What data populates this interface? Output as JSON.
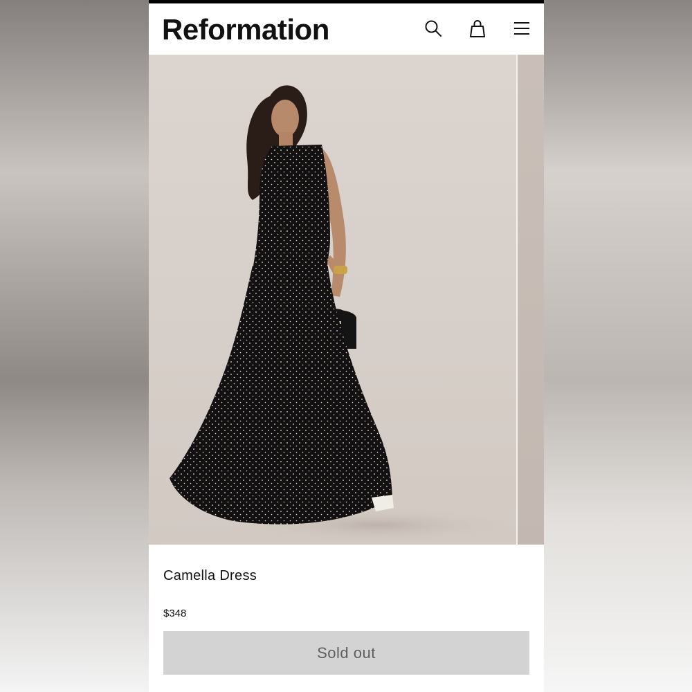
{
  "header": {
    "logo_text": "Reformation",
    "icons": [
      "search-icon",
      "shopping-bag-icon",
      "menu-icon"
    ]
  },
  "gallery": {
    "image_description_visible": false
  },
  "product": {
    "name": "Camella Dress",
    "price": "$348",
    "button_label": "Sold out"
  },
  "colors": {
    "header_bg": "#ffffff",
    "logo": "#111111",
    "button_bg": "#d3d3d3",
    "button_text": "#5e5e5e",
    "photo_bg": "#d8d0ca"
  }
}
